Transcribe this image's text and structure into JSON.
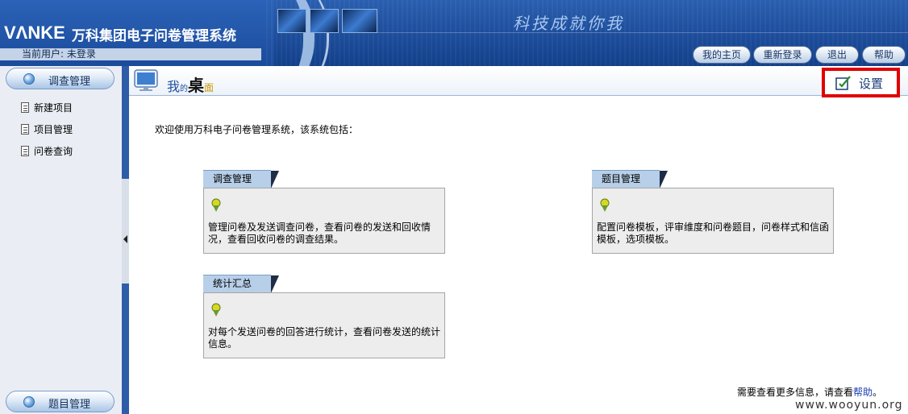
{
  "header": {
    "logo": "VΛNKE",
    "system_title": "万科集团电子问卷管理系统",
    "current_user": "当前用户: 未登录",
    "slogan": "科技成就你我",
    "buttons": [
      {
        "label": "我的主页"
      },
      {
        "label": "重新登录"
      },
      {
        "label": "退出"
      },
      {
        "label": "帮助"
      }
    ]
  },
  "sidebar": {
    "top_tab": "调查管理",
    "items": [
      {
        "label": "新建项目"
      },
      {
        "label": "项目管理"
      },
      {
        "label": "问卷查询"
      }
    ],
    "bottom_tab": "题目管理"
  },
  "desktop": {
    "title_parts": [
      "我",
      "的",
      "桌",
      "面"
    ],
    "settings_label": "设置",
    "welcome": "欢迎使用万科电子问卷管理系统，该系统包括：",
    "panels": [
      {
        "title": "调查管理",
        "desc": "管理问卷及发送调查问卷，查看问卷的发送和回收情况，查看回收问卷的调查结果。"
      },
      {
        "title": "题目管理",
        "desc": "配置问卷模板，评审维度和问卷题目，问卷样式和信函模板，选项模板。"
      },
      {
        "title": "统计汇总",
        "desc": "对每个发送问卷的回答进行统计，查看问卷发送的统计信息。"
      }
    ],
    "more_info_prefix": "需要查看更多信息，请查看",
    "more_info_link": "帮助",
    "more_info_suffix": "。"
  },
  "watermark": "www.wooyun.org",
  "colors": {
    "header_blue": "#1f4f9e",
    "settings_highlight": "#e00000",
    "panel_tab": "#b7cfe8",
    "panel_body": "#ededed"
  }
}
